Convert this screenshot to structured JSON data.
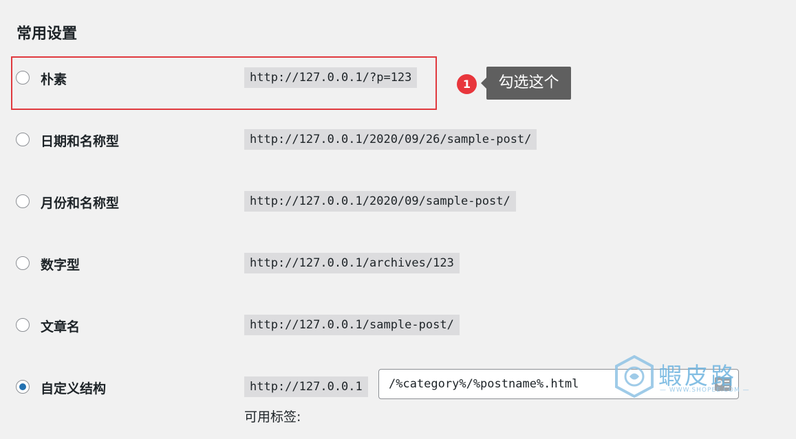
{
  "page": {
    "title": "常用设置"
  },
  "options": [
    {
      "label": "朴素",
      "example": "http://127.0.0.1/?p=123",
      "checked": false
    },
    {
      "label": "日期和名称型",
      "example": "http://127.0.0.1/2020/09/26/sample-post/",
      "checked": false
    },
    {
      "label": "月份和名称型",
      "example": "http://127.0.0.1/2020/09/sample-post/",
      "checked": false
    },
    {
      "label": "数字型",
      "example": "http://127.0.0.1/archives/123",
      "checked": false
    },
    {
      "label": "文章名",
      "example": "http://127.0.0.1/sample-post/",
      "checked": false
    },
    {
      "label": "自定义结构",
      "example": "http://127.0.0.1",
      "checked": true
    }
  ],
  "custom_structure": {
    "value": "/%category%/%postname%.html",
    "available_tags_label": "可用标签:"
  },
  "annotation": {
    "step_number": "1",
    "tooltip": "勾选这个",
    "highlight_color": "#e0393e",
    "badge_color": "#e8363c"
  },
  "watermark": {
    "title": "蝦皮路",
    "subtitle": "— WWW.SHOPEE.COM —"
  },
  "colors": {
    "accent": "#2271b1",
    "background": "#f1f1f1",
    "code_background": "#dcdcde"
  },
  "icons": {
    "input_action": "contact-card-icon"
  }
}
